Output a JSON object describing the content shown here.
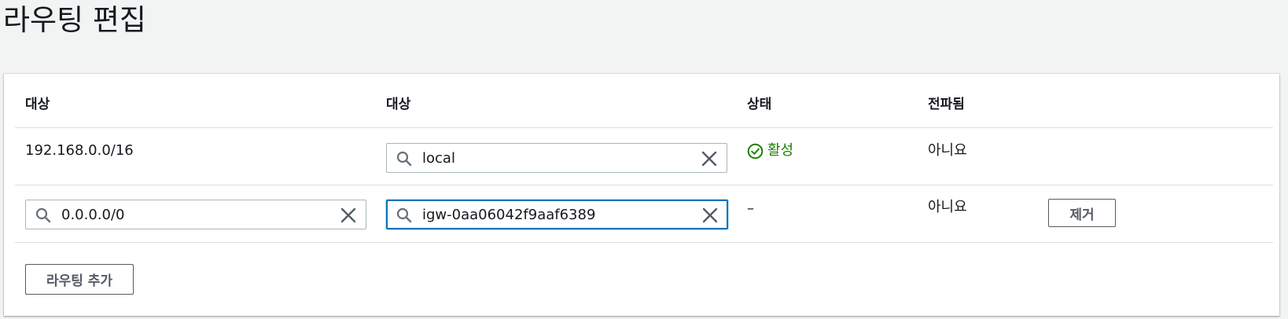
{
  "page": {
    "title": "라우팅 편집"
  },
  "table": {
    "columns": [
      "대상",
      "대상",
      "상태",
      "전파됨"
    ],
    "rows": [
      {
        "destination": "192.168.0.0/16",
        "target_value": "local",
        "status": "활성",
        "propagated": "아니요"
      },
      {
        "destination_value": "0.0.0.0/0",
        "target_value": "igw-0aa06042f9aaf6389",
        "status": "–",
        "propagated": "아니요",
        "remove_label": "제거"
      }
    ]
  },
  "actions": {
    "add_route_label": "라우팅 추가"
  },
  "colors": {
    "status_active": "#1d8102",
    "focus_border": "#0073bb",
    "background": "#f2f3f3"
  },
  "icons": [
    "search-icon",
    "clear-icon",
    "check-circle-icon"
  ]
}
